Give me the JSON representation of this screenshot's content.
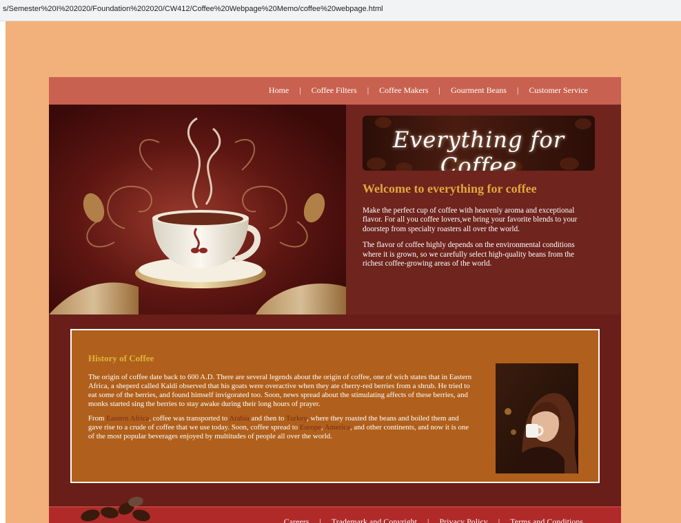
{
  "browser": {
    "url": "s/Semester%20I%202020/Foundation%202020/CW412/Coffee%20Webpage%20Memo/coffee%20webpage.html"
  },
  "nav": {
    "items": [
      "Home",
      "Coffee Filters",
      "Coffee Makers",
      "Gourment Beans",
      "Customer Service"
    ],
    "separator": "|"
  },
  "banner": {
    "text": "Everything for Coffee"
  },
  "welcome": {
    "title": "Welcome to everything for coffee",
    "paragraphs": [
      "Make the perfect cup of coffee with heavenly aroma and exceptional flavor. For all you coffee lovers,we bring your favorite blends to your doorstep from specialty roasters all over the world.",
      "The flavor of coffee highly depends on the environmental conditions where it is grown, so we carefully select high-quality beans from the richest coffee-growing areas of the world."
    ]
  },
  "history": {
    "title": "History of Coffee",
    "p1": "The origin of coffee date back to 600 A.D. There are several legends about the origin of coffee, one of wich states that in Eastern Africa, a sheperd called Kaldi observed that his goats were overactive when they ate cherry-red berries from a shrub. He tried to eat some of the berries, and found himself invigorated too. Soon, news spread about the stimulating affects of these berries, and monks started sing the berries to stay awake during their long hours of prayer.",
    "p2": {
      "t1": "From ",
      "h1": "Eastern Africa",
      "t2": ", coffee was transported to ",
      "h2": "Arabia",
      "t3": " and then to ",
      "h3": "Turkey",
      "t4": ", where they roasted the beans and boiled them and gave rise to a crude of coffee that we use today. Soon, coffee spread to ",
      "h4": "Europe",
      "t5": ", ",
      "h5": "America",
      "t6": ", and other continents, and now it is one of the most popular beverages enjoyed by multitudes of people all over the world."
    }
  },
  "footer": {
    "items": [
      "Careers",
      "Trademark and Copyright",
      "Privacy Policy",
      "Terms and Conditions"
    ],
    "separator": "|"
  },
  "colors": {
    "page_bg": "#f2b07a",
    "nav_bg": "#c8614f",
    "hero_bg": "#6f241e",
    "heading_gold": "#e0a93b",
    "history_bg": "#b0601c",
    "footer_bg": "#b02a2a"
  }
}
